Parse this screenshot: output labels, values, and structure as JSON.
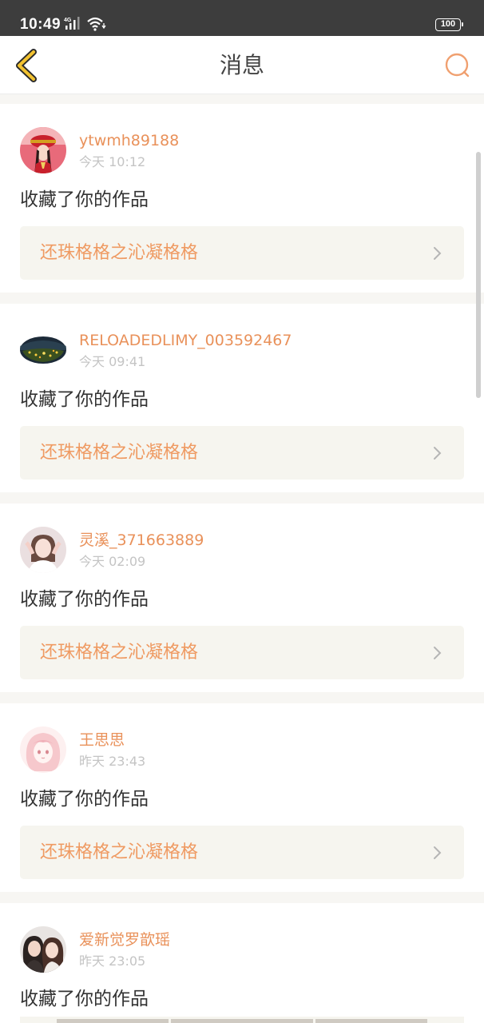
{
  "status_bar": {
    "time": "10:49",
    "network": "4G",
    "battery": "100"
  },
  "nav": {
    "title": "消息",
    "back_icon": "back-chevron-icon",
    "search_icon": "search-icon"
  },
  "colors": {
    "accent": "#e9915a",
    "work_title": "#ef9a62",
    "back_icon": "#f2c230",
    "card_bg": "#ffffff",
    "page_bg": "#f7f6f3",
    "work_bg": "#f6f5ef"
  },
  "messages": [
    {
      "username": "ytwmh89188",
      "time": "今天 10:12",
      "action": "收藏了你的作品",
      "work_title": "还珠格格之沁凝格格",
      "avatar": "avatar-girl-red-costume"
    },
    {
      "username": "RELOADEDLIMY_003592467",
      "time": "今天 09:41",
      "action": "收藏了你的作品",
      "work_title": "还珠格格之沁凝格格",
      "avatar": "avatar-night-landscape"
    },
    {
      "username": "灵溪_371663889",
      "time": "今天 02:09",
      "action": "收藏了你的作品",
      "work_title": "还珠格格之沁凝格格",
      "avatar": "avatar-girl-white-dress"
    },
    {
      "username": "王思思",
      "time": "昨天 23:43",
      "action": "收藏了你的作品",
      "work_title": "还珠格格之沁凝格格",
      "avatar": "avatar-anime-girl-pink"
    },
    {
      "username": "爱新觉罗歆瑶",
      "time": "昨天 23:05",
      "action": "收藏了你的作品",
      "work_title": "",
      "avatar": "avatar-two-girls"
    }
  ]
}
